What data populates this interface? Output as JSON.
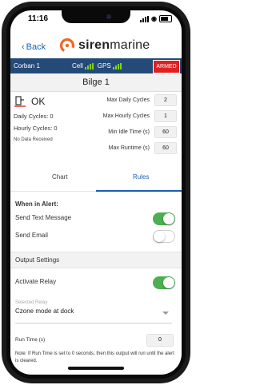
{
  "status_bar": {
    "time": "11:16"
  },
  "nav": {
    "back_label": "Back",
    "logo_bold": "siren",
    "logo_light": "marine"
  },
  "topbar": {
    "boat_name": "Corban 1",
    "cell_label": "Cell",
    "gps_label": "GPS",
    "armed_label": "ARMED"
  },
  "sensor": {
    "title": "Bilge 1",
    "status": "OK",
    "daily_cycles": "Daily Cycles: 0",
    "hourly_cycles": "Hourly Cycles: 0",
    "no_data": "No Data Received"
  },
  "settings": [
    {
      "label": "Max Daily Cycles",
      "value": "2"
    },
    {
      "label": "Max Hourly Cycles",
      "value": "1"
    },
    {
      "label": "Min Idle Time (s)",
      "value": "60"
    },
    {
      "label": "Max Runtime (s)",
      "value": "60"
    }
  ],
  "tabs": {
    "chart": "Chart",
    "rules": "Rules"
  },
  "alerts": {
    "heading": "When in Alert:",
    "send_text": "Send Text Message",
    "send_email": "Send Email",
    "send_text_on": true,
    "send_email_on": false
  },
  "output": {
    "heading": "Output Settings",
    "activate_relay": "Activate Relay",
    "activate_relay_on": true,
    "selected_relay_caption": "Selected Relay",
    "selected_relay_value": "Czone mode at dock",
    "run_time_label": "Run Time (s)",
    "run_time_value": "0",
    "note": "Note: If Run Time is set to 0 seconds, then this output will run until the alert is cleared."
  },
  "colors": {
    "brand_blue": "#244a78",
    "logo_orange": "#f26722",
    "toggle_green": "#4caf50",
    "armed_red": "#e02020",
    "link_blue": "#1a5fb4"
  }
}
